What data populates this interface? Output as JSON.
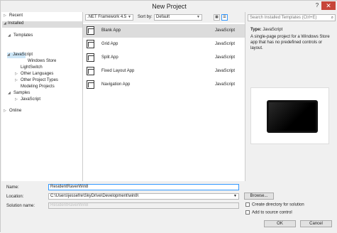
{
  "window": {
    "title": "New Project",
    "help": "?",
    "close": "✕"
  },
  "nav": {
    "recent": "Recent",
    "installed": "Installed",
    "templates": "Templates",
    "javascript": "JavaScript",
    "windows_store": "Windows Store",
    "lightswitch": "LightSwitch",
    "other_languages": "Other Languages",
    "other_project_types": "Other Project Types",
    "modeling_projects": "Modeling Projects",
    "samples": "Samples",
    "samples_javascript": "JavaScript",
    "online": "Online"
  },
  "toolbar": {
    "framework": ".NET Framework 4.5",
    "sort_label": "Sort by:",
    "sort_value": "Default"
  },
  "templates": [
    {
      "name": "Blank App",
      "lang": "JavaScript"
    },
    {
      "name": "Grid App",
      "lang": "JavaScript"
    },
    {
      "name": "Split App",
      "lang": "JavaScript"
    },
    {
      "name": "Fixed Layout App",
      "lang": "JavaScript"
    },
    {
      "name": "Navigation App",
      "lang": "JavaScript"
    }
  ],
  "details": {
    "search_placeholder": "Search Installed Templates (Ctrl+E)",
    "type_label": "Type:",
    "type_value": "JavaScript",
    "description": "A single-page project for a Windows Store app that has no predefined controls or layout."
  },
  "form": {
    "name_label": "Name:",
    "name_value": "ResidentRaverWin8",
    "location_label": "Location:",
    "location_value": "C:\\Users\\jessefre\\SkyDrive\\Development\\win8\\",
    "solution_label": "Solution name:",
    "solution_value": "ResidentRaverWin8",
    "browse": "Browse...",
    "create_dir": "Create directory for solution",
    "add_source": "Add to source control",
    "ok": "OK",
    "cancel": "Cancel"
  }
}
